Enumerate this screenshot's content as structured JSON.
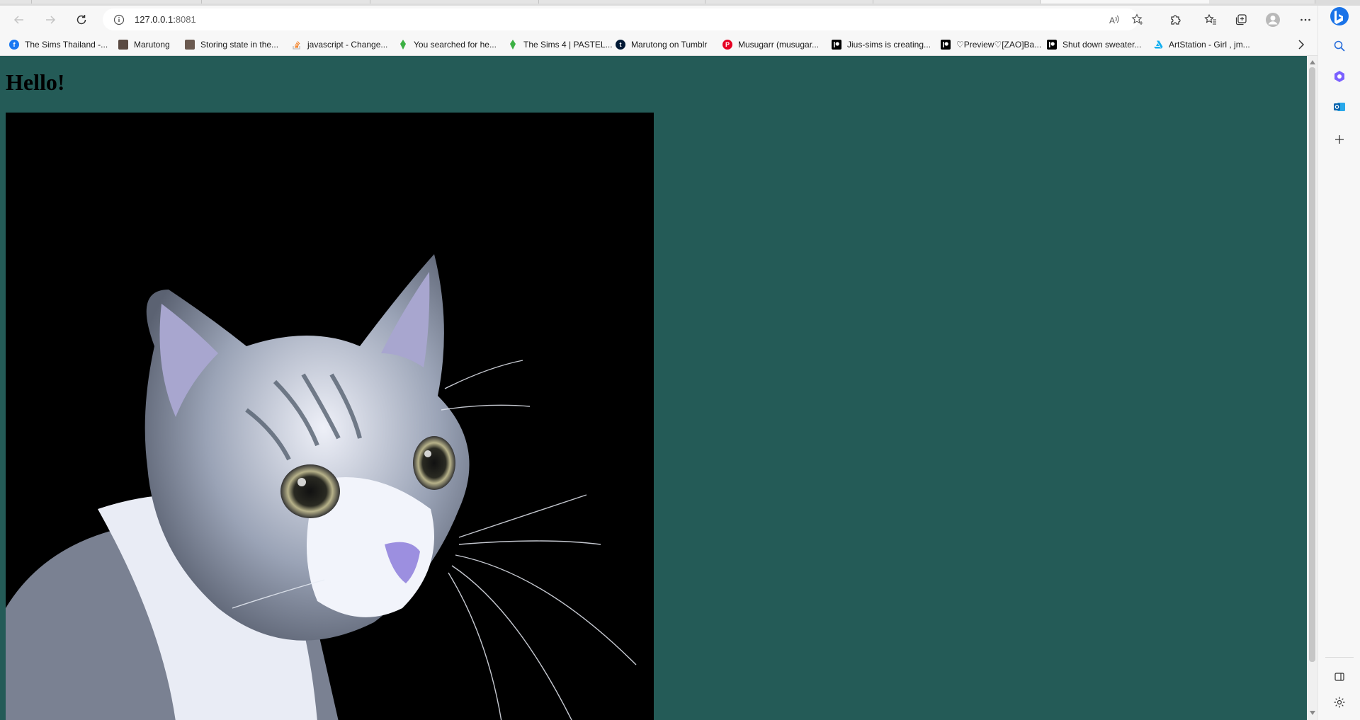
{
  "browser": {
    "address_bar": {
      "host": "127.0.0.1:",
      "port": "8081"
    },
    "toolbar": {
      "back_icon": "back-arrow-icon",
      "forward_icon": "forward-arrow-icon",
      "refresh_icon": "refresh-icon",
      "site_info_icon": "info-icon",
      "read_aloud_icon": "read-aloud-icon",
      "favorite_icon": "add-favorite-icon",
      "extensions_icon": "puzzle-icon",
      "favorites_icon": "favorites-icon",
      "collections_icon": "collections-icon",
      "profile_icon": "profile-icon",
      "more_icon": "ellipsis-icon",
      "copilot_icon": "bing-icon"
    },
    "bookmarks": [
      {
        "label": "The Sims Thailand -...",
        "icon": "facebook-icon",
        "color": "#1877f2"
      },
      {
        "label": "Marutong",
        "icon": "avatar-icon",
        "color": "#5a4a42"
      },
      {
        "label": "Storing state in the...",
        "icon": "avatar-icon",
        "color": "#6b5a50"
      },
      {
        "label": "javascript - Change...",
        "icon": "stackoverflow-icon",
        "color": "#f48024"
      },
      {
        "label": "You searched for he...",
        "icon": "plumbob-icon",
        "color": "#3cb043"
      },
      {
        "label": "The Sims 4 | PASTEL...",
        "icon": "plumbob-icon",
        "color": "#3cb043"
      },
      {
        "label": "Marutong on Tumblr",
        "icon": "tumblr-icon",
        "color": "#001935"
      },
      {
        "label": "Musugarr (musugar...",
        "icon": "pinterest-icon",
        "color": "#e60023"
      },
      {
        "label": "Jius-sims is creating...",
        "icon": "patreon-icon",
        "color": "#000000"
      },
      {
        "label": "♡Preview♡[ZAO]Ba...",
        "icon": "patreon-icon",
        "color": "#000000"
      },
      {
        "label": "Shut down sweater...",
        "icon": "patreon-icon",
        "color": "#000000"
      },
      {
        "label": "ArtStation - Girl , jm...",
        "icon": "artstation-icon",
        "color": "#13aff0"
      }
    ],
    "sidebar": {
      "search_icon": "search-icon",
      "copilot_icon": "copilot-icon",
      "outlook_icon": "outlook-icon",
      "add_icon": "plus-icon",
      "split_icon": "split-screen-icon",
      "settings_icon": "gear-icon"
    }
  },
  "page": {
    "heading": "Hello!",
    "background_color": "#245b57",
    "image": {
      "subject": "cat-photo",
      "background_color": "#000000"
    }
  }
}
